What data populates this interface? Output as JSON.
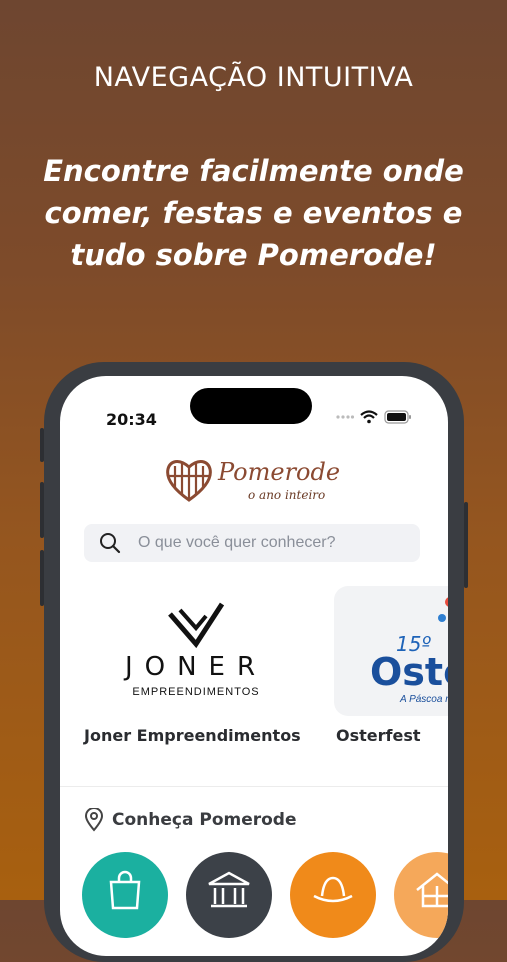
{
  "header": {
    "headline": "NAVEGAÇÃO INTUITIVA",
    "tagline": "Encontre facilmente onde comer, festas e eventos e tudo sobre Pomerode!"
  },
  "status_bar": {
    "time": "20:34"
  },
  "logo": {
    "name": "Pomerode",
    "subtitle": "o ano inteiro"
  },
  "search": {
    "placeholder": "O que você quer conhecer?"
  },
  "carousel": {
    "items": [
      {
        "title": "Joner Empreendimentos",
        "logo_main": "JONER",
        "logo_sub": "EMPREENDIMENTOS"
      },
      {
        "title": "Osterfest",
        "logo_number": "15º",
        "logo_main": "Oste",
        "logo_script": "A Páscoa m"
      }
    ]
  },
  "section": {
    "title": "Conheça Pomerode"
  },
  "categories": [
    {
      "icon": "shopping-bag-icon",
      "color": "#1bb0a0"
    },
    {
      "icon": "museum-icon",
      "color": "#3c4148"
    },
    {
      "icon": "hat-icon",
      "color": "#f08a1a"
    },
    {
      "icon": "house-icon",
      "color": "#f5a85a"
    }
  ],
  "colors": {
    "brand": "#7b4a32",
    "accent_orange": "#f08a1a",
    "teal": "#1bb0a0"
  }
}
